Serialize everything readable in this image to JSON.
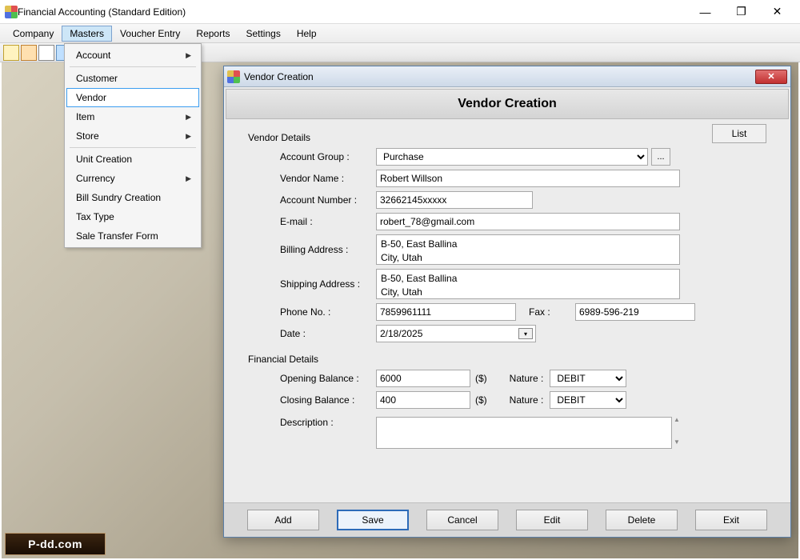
{
  "window": {
    "title": "Financial Accounting (Standard Edition)"
  },
  "menubar": {
    "items": [
      "Company",
      "Masters",
      "Voucher Entry",
      "Reports",
      "Settings",
      "Help"
    ],
    "active_index": 1
  },
  "dropdown": {
    "items": [
      {
        "label": "Account",
        "arrow": true
      },
      {
        "sep": true
      },
      {
        "label": "Customer"
      },
      {
        "label": "Vendor",
        "selected": true
      },
      {
        "label": "Item",
        "arrow": true
      },
      {
        "label": "Store",
        "arrow": true
      },
      {
        "sep": true
      },
      {
        "label": "Unit Creation"
      },
      {
        "label": "Currency",
        "arrow": true
      },
      {
        "label": "Bill Sundry Creation"
      },
      {
        "label": "Tax Type"
      },
      {
        "label": "Sale Transfer Form"
      }
    ]
  },
  "dialog": {
    "title": "Vendor Creation",
    "header": "Vendor Creation",
    "list_button": "List",
    "sections": {
      "vendor_details": "Vendor Details",
      "financial_details": "Financial Details"
    },
    "labels": {
      "account_group": "Account Group  :",
      "vendor_name": "Vendor Name  :",
      "account_number": "Account Number  :",
      "email": "E-mail  :",
      "billing_address": "Billing Address  :",
      "shipping_address": "Shipping Address  :",
      "phone": "Phone No.  :",
      "fax": "Fax  :",
      "date": "Date  :",
      "opening_balance": "Opening Balance  :",
      "closing_balance": "Closing Balance  :",
      "nature": "Nature :",
      "description": "Description  :",
      "currency": "($)"
    },
    "values": {
      "account_group": "Purchase",
      "vendor_name": "Robert Willson",
      "account_number": "32662145xxxxx",
      "email": "robert_78@gmail.com",
      "billing_address": "B-50, East Ballina\nCity, Utah",
      "shipping_address": "B-50, East Ballina\nCity, Utah",
      "phone": "7859961111",
      "fax": "6989-596-219",
      "date": "2/18/2025",
      "opening_balance": "6000",
      "closing_balance": "400",
      "opening_nature": "DEBIT",
      "closing_nature": "DEBIT",
      "description": ""
    },
    "buttons": {
      "add": "Add",
      "save": "Save",
      "cancel": "Cancel",
      "edit": "Edit",
      "delete": "Delete",
      "exit": "Exit"
    },
    "ellipsis": "..."
  },
  "watermark": "P-dd.com"
}
